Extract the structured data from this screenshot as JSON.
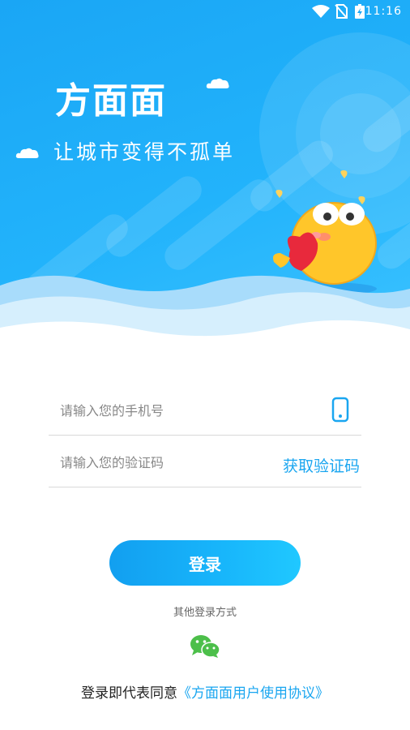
{
  "status_bar": {
    "time": "11:16"
  },
  "brand": {
    "logo_text": "方面面",
    "slogan": "让城市变得不孤单"
  },
  "form": {
    "phone_placeholder": "请输入您的手机号",
    "code_placeholder": "请输入您的验证码",
    "get_code_label": "获取验证码"
  },
  "login_button": "登录",
  "other_login_label": "其他登录方式",
  "agreement": {
    "prefix": "登录即代表同意",
    "link": "《方面面用户使用协议》"
  },
  "colors": {
    "primary": "#1aa6f0",
    "hero_bg": "#22b3fb",
    "wechat": "#4cbf4a"
  },
  "icons": {
    "phone": "phone-icon",
    "wechat": "wechat-icon"
  }
}
